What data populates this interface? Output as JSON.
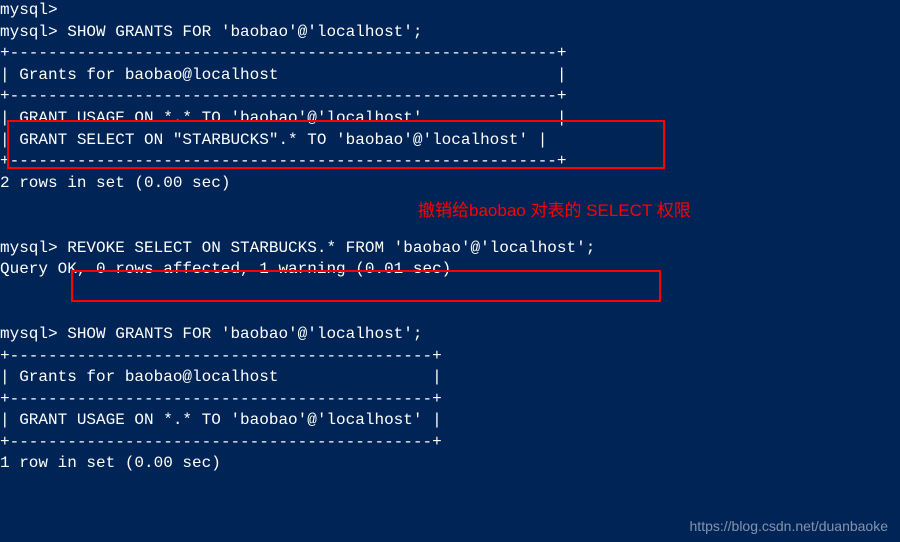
{
  "terminal": {
    "line0": "mysql>",
    "line1": "mysql> SHOW GRANTS FOR 'baobao'@'localhost';",
    "line2": "+---------------------------------------------------------+",
    "line3": "| Grants for baobao@localhost                             |",
    "line4": "+---------------------------------------------------------+",
    "line5": "| GRANT USAGE ON *.* TO 'baobao'@'localhost'              |",
    "line6": "| GRANT SELECT ON \"STARBUCKS\".* TO 'baobao'@'localhost' |",
    "line7": "+---------------------------------------------------------+",
    "line8": "2 rows in set (0.00 sec)",
    "blank1": "",
    "blank2": "",
    "line9": "mysql> REVOKE SELECT ON STARBUCKS.* FROM 'baobao'@'localhost';",
    "line10": "Query OK, 0 rows affected, 1 warning (0.01 sec)",
    "blank3": "",
    "blank4": "",
    "line11": "mysql> SHOW GRANTS FOR 'baobao'@'localhost';",
    "line12": "+--------------------------------------------+",
    "line13": "| Grants for baobao@localhost                |",
    "line14": "+--------------------------------------------+",
    "line15": "| GRANT USAGE ON *.* TO 'baobao'@'localhost' |",
    "line16": "+--------------------------------------------+",
    "line17": "1 row in set (0.00 sec)"
  },
  "annotation": "撤销给baobao 对表的 SELECT 权限",
  "watermark": "https://blog.csdn.net/duanbaoke"
}
